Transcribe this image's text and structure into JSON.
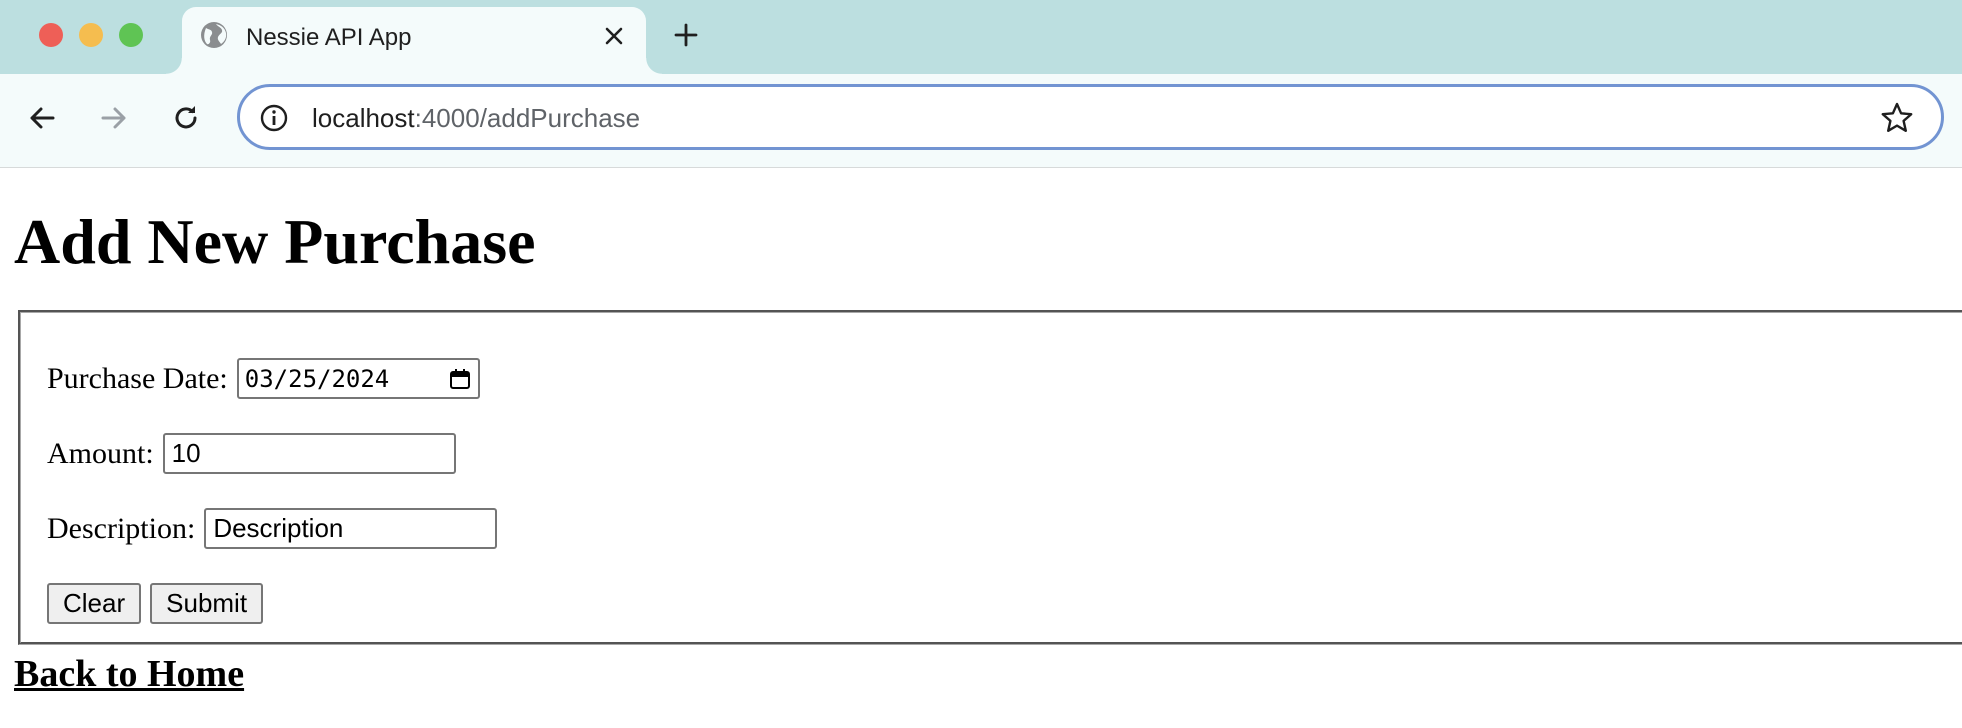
{
  "browser": {
    "tab": {
      "title": "Nessie API App",
      "favicon": "globe-icon"
    },
    "address_bar": {
      "host": "localhost",
      "path": ":4000/addPurchase"
    },
    "icons": {
      "back": "arrow-left-icon",
      "forward": "arrow-right-icon",
      "reload": "reload-icon",
      "site_info": "info-icon",
      "bookmark": "star-icon",
      "close_tab": "close-icon",
      "new_tab": "plus-icon"
    },
    "colors": {
      "tab_strip": "#bcdfe0",
      "toolbar": "#f4fbfb",
      "omnibox_focus": "#7294d2"
    }
  },
  "page": {
    "heading": "Add New Purchase",
    "form": {
      "purchase_date": {
        "label": "Purchase Date:",
        "value": "03/25/2024",
        "icon": "calendar-icon"
      },
      "amount": {
        "label": "Amount:",
        "value": "10"
      },
      "description": {
        "label": "Description:",
        "value": "Description"
      },
      "buttons": {
        "clear": "Clear",
        "submit": "Submit"
      }
    },
    "back_link": "Back to Home"
  }
}
